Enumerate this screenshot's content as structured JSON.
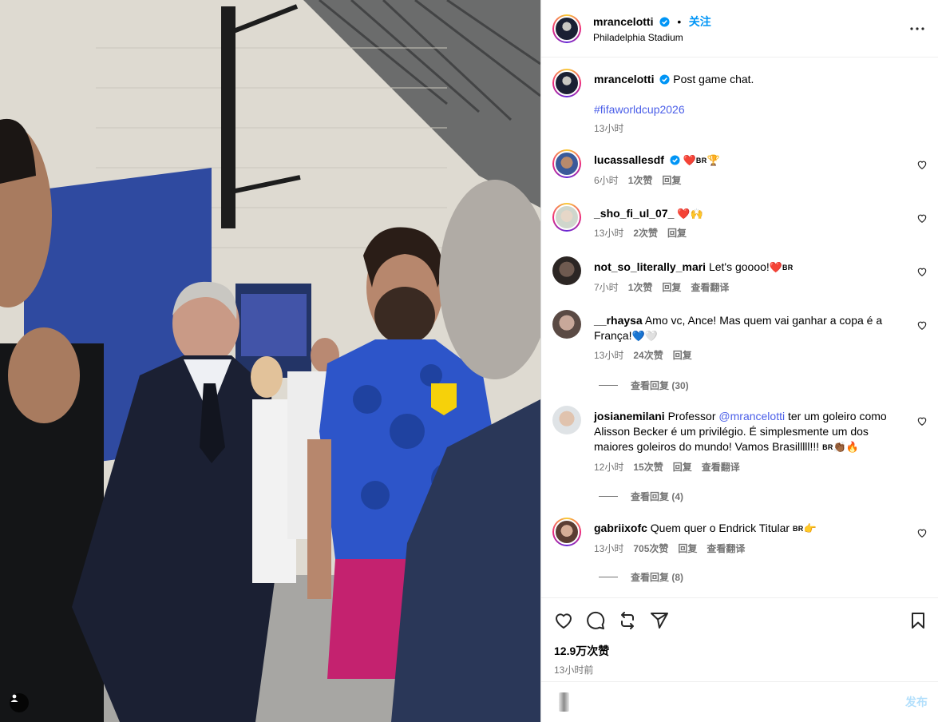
{
  "post": {
    "username": "mrancelotti",
    "follow_label": "关注",
    "separator": "•",
    "location": "Philadelphia Stadium",
    "caption": "Post game chat.",
    "hashtag": "#fifaworldcup2026",
    "caption_time": "13小时"
  },
  "comments": [
    {
      "username": "lucassallesdf",
      "verified": true,
      "text": "",
      "emoji": [
        "❤️",
        "BR",
        "🏆"
      ],
      "time": "6小时",
      "likes": "1次赞",
      "reply": "回复",
      "translate": ""
    },
    {
      "username": "_sho_fi_ul_07_",
      "verified": false,
      "text": "",
      "emoji": [
        "❤️",
        "🙌"
      ],
      "time": "13小时",
      "likes": "2次赞",
      "reply": "回复",
      "translate": ""
    },
    {
      "username": "not_so_literally_mari",
      "verified": false,
      "text": "Let's goooo!",
      "emoji": [
        "❤️",
        "BR"
      ],
      "time": "7小时",
      "likes": "1次赞",
      "reply": "回复",
      "translate": "查看翻译"
    },
    {
      "username": "__rhaysa",
      "verified": false,
      "text": "Amo vc, Ance! Mas quem vai ganhar a copa é a França!",
      "emoji": [
        "💙",
        "🤍"
      ],
      "time": "13小时",
      "likes": "24次赞",
      "reply": "回复",
      "translate": "",
      "view_replies": "查看回复 (30)"
    },
    {
      "username": "josianemilani",
      "verified": false,
      "text_before": "Professor ",
      "mention": "@mrancelotti",
      "text": " ter um goleiro como Alisson Becker é um privilégio. É simplesmente um dos maiores goleiros do mundo! Vamos Brasilllll!!! ",
      "emoji": [
        "BR",
        "👏🏾",
        "🔥"
      ],
      "time": "12小时",
      "likes": "15次赞",
      "reply": "回复",
      "translate": "查看翻译",
      "view_replies": "查看回复 (4)"
    },
    {
      "username": "gabriixofc",
      "verified": false,
      "text": "Quem quer o Endrick Titular",
      "emoji": [
        "BR",
        "👉"
      ],
      "time": "13小时",
      "likes": "705次赞",
      "reply": "回复",
      "translate": "查看翻译",
      "view_replies": "查看回复 (8)"
    }
  ],
  "footer": {
    "likes": "12.9万次赞",
    "time": "13小时前",
    "comment_placeholder": "",
    "post_label": "发布"
  },
  "icons": [
    "like-icon",
    "comment-icon",
    "repost-icon",
    "share-icon",
    "save-icon",
    "more-options-icon",
    "verified-badge-icon",
    "tagged-user-icon"
  ]
}
